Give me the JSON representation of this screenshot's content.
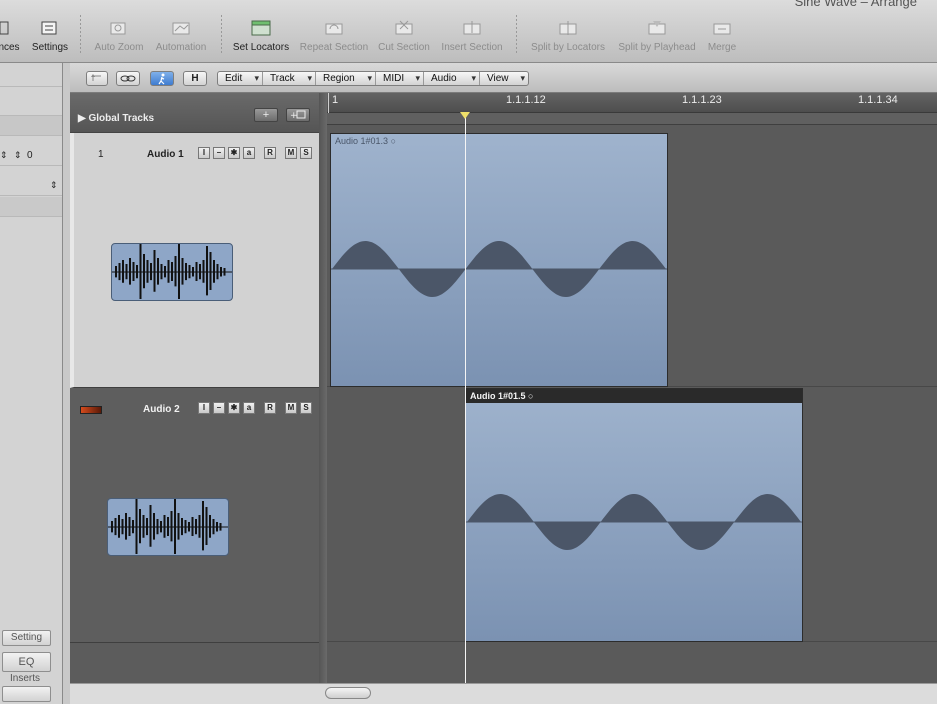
{
  "window": {
    "title": "Sine Wave – Arrange"
  },
  "toolbar": {
    "buttons": [
      {
        "label": "nces",
        "enabled": true
      },
      {
        "label": "Settings",
        "enabled": true
      },
      {
        "label": "Auto Zoom",
        "enabled": false
      },
      {
        "label": "Automation",
        "enabled": false
      },
      {
        "label": "Set Locators",
        "enabled": true
      },
      {
        "label": "Repeat Section",
        "enabled": false
      },
      {
        "label": "Cut Section",
        "enabled": false
      },
      {
        "label": "Insert Section",
        "enabled": false
      },
      {
        "label": "Split by Locators",
        "enabled": false
      },
      {
        "label": "Split by Playhead",
        "enabled": false
      },
      {
        "label": "Merge",
        "enabled": false
      }
    ]
  },
  "inspector": {
    "field_value": "0",
    "setting_label": "Setting",
    "eq_label": "EQ",
    "inserts_label": "Inserts"
  },
  "local_bar": {
    "h_label": "H",
    "menus": [
      "Edit",
      "Track",
      "Region",
      "MIDI",
      "Audio",
      "View"
    ]
  },
  "track_list": {
    "global_tracks_label": "Global Tracks",
    "add_label": "+",
    "tracks": [
      {
        "number": "1",
        "name": "Audio 1"
      },
      {
        "number": "",
        "name": "Audio 2"
      }
    ],
    "track_buttons": [
      "I",
      "–",
      "✱",
      "a",
      "R",
      "M",
      "S"
    ]
  },
  "ruler": {
    "ticks": [
      "1",
      "1.1.1.12",
      "1.1.1.23",
      "1.1.1.34"
    ]
  },
  "regions": [
    {
      "name": "Audio 1#01.3",
      "track": 1,
      "selected": false
    },
    {
      "name": "Audio 1#01.5",
      "track": 2,
      "selected": true
    }
  ]
}
